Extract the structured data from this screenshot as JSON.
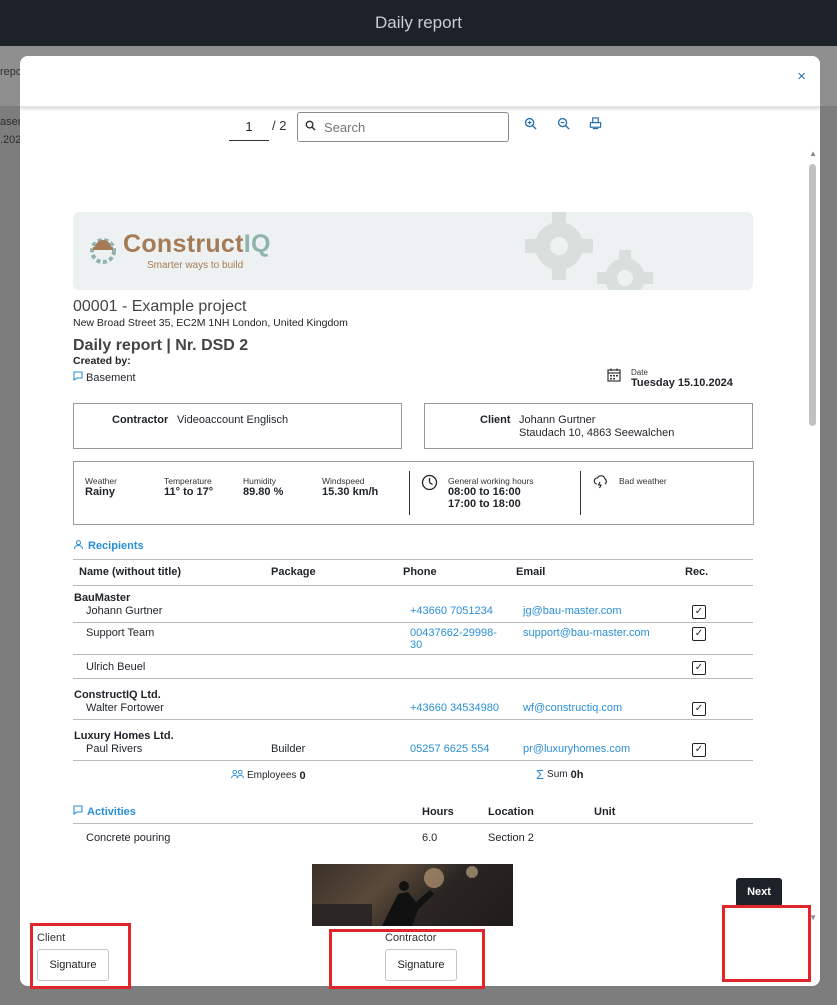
{
  "app": {
    "title": "Daily report"
  },
  "background": {
    "t1": "repo",
    "t2": "asem",
    "t3": ".202"
  },
  "viewer": {
    "page_current": "1",
    "page_total": "/ 2",
    "search_placeholder": "Search"
  },
  "brand": {
    "name_a": "Construct",
    "name_b": "IQ",
    "tagline": "Smarter ways to build"
  },
  "project": {
    "title": "00001 - Example project",
    "address": "New Broad Street 35, EC2M 1NH London, United Kingdom",
    "report_title": "Daily report | Nr. DSD 2",
    "created_by": "Created by:",
    "location": "Basement",
    "date_label": "Date",
    "date_value": "Tuesday 15.10.2024"
  },
  "contractor": {
    "label": "Contractor",
    "value": "Videoaccount Englisch"
  },
  "client": {
    "label": "Client",
    "name": "Johann Gurtner",
    "address": "Staudach 10, 4863 Seewalchen"
  },
  "weather": {
    "weather_label": "Weather",
    "weather_value": "Rainy",
    "temp_label": "Temperature",
    "temp_value": "11° to 17°",
    "humidity_label": "Humidity",
    "humidity_value": "89.80 %",
    "wind_label": "Windspeed",
    "wind_value": "15.30 km/h",
    "hours_label": "General working hours",
    "hours_1": "08:00 to 16:00",
    "hours_2": "17:00 to 18:00",
    "bad_weather": "Bad weather"
  },
  "recipients": {
    "title": "Recipients",
    "headers": [
      "Name (without title)",
      "Package",
      "Phone",
      "Email",
      "Rec."
    ],
    "groups": [
      {
        "name": "BauMaster",
        "rows": [
          {
            "name": "Johann Gurtner",
            "package": "",
            "phone": "+43660 7051234",
            "email": "jg@bau-master.com"
          },
          {
            "name": "Support Team",
            "package": "",
            "phone": "00437662-29998-30",
            "email": "support@bau-master.com"
          },
          {
            "name": "Ulrich Beuel",
            "package": "",
            "phone": "",
            "email": ""
          }
        ]
      },
      {
        "name": "ConstructIQ Ltd.",
        "rows": [
          {
            "name": "Walter Fortower",
            "package": "",
            "phone": "+43660 34534980",
            "email": "wf@constructiq.com"
          }
        ]
      },
      {
        "name": "Luxury Homes Ltd.",
        "rows": [
          {
            "name": "Paul Rivers",
            "package": "Builder",
            "phone": "05257 6625 554",
            "email": "pr@luxuryhomes.com"
          }
        ]
      }
    ],
    "employees_label": "Employees",
    "employees_value": "0",
    "sum_label": "Sum",
    "sum_value": "0h"
  },
  "activities": {
    "title": "Activities",
    "headers": [
      "Hours",
      "Location",
      "Unit"
    ],
    "rows": [
      {
        "name": "Concrete pouring",
        "hours": "6.0",
        "location": "Section 2",
        "unit": ""
      }
    ]
  },
  "signatures": {
    "client_label": "Client",
    "contractor_label": "Contractor",
    "button_label": "Signature"
  },
  "actions": {
    "next": "Next",
    "close": "×"
  },
  "accent": {
    "link": "#2a8fd6",
    "highlight": "#e0262a",
    "dark": "#1d2128"
  }
}
